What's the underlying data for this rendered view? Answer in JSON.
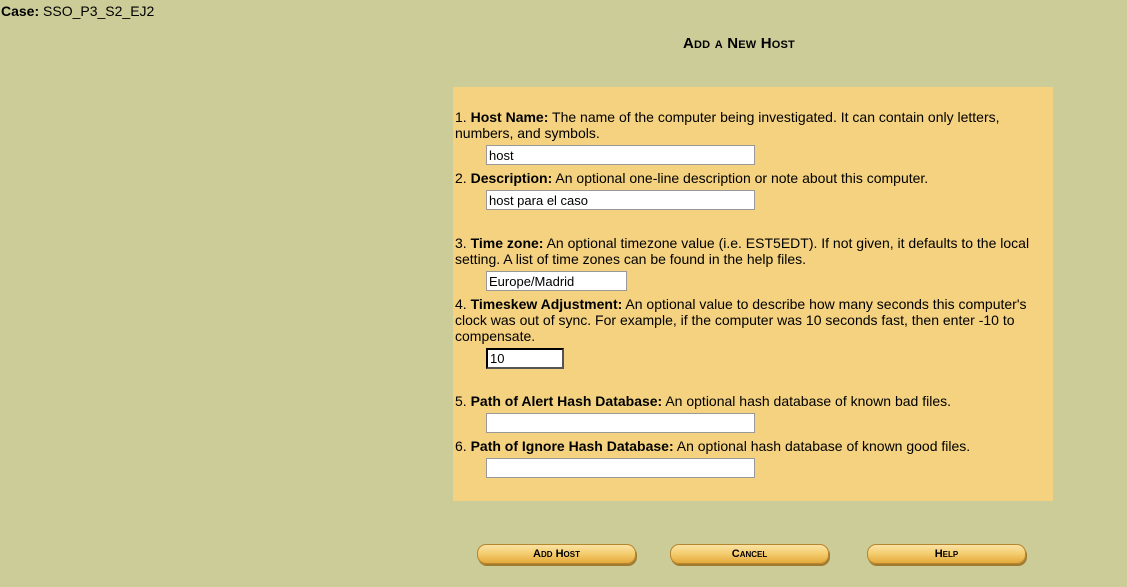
{
  "case": {
    "label": "Case:",
    "value": "SSO_P3_S2_EJ2"
  },
  "title": "Add a New Host",
  "fields": [
    {
      "num": "1.",
      "label": "Host Name:",
      "desc": "The name of the computer being investigated. It can contain only letters, numbers, and symbols.",
      "value": "host"
    },
    {
      "num": "2.",
      "label": "Description:",
      "desc": "An optional one-line description or note about this computer.",
      "value": "host para el caso"
    },
    {
      "num": "3.",
      "label": "Time zone:",
      "desc": "An optional timezone value (i.e. EST5EDT). If not given, it defaults to the local setting. A list of time zones can be found in the help files.",
      "value": "Europe/Madrid"
    },
    {
      "num": "4.",
      "label": "Timeskew Adjustment:",
      "desc": "An optional value to describe how many seconds this computer's clock was out of sync. For example, if the computer was 10 seconds fast, then enter -10 to compensate.",
      "value": "10"
    },
    {
      "num": "5.",
      "label": "Path of Alert Hash Database:",
      "desc": "An optional hash database of known bad files.",
      "value": ""
    },
    {
      "num": "6.",
      "label": "Path of Ignore Hash Database:",
      "desc": "An optional hash database of known good files.",
      "value": ""
    }
  ],
  "buttons": {
    "add": "Add Host",
    "cancel": "Cancel",
    "help": "Help"
  }
}
